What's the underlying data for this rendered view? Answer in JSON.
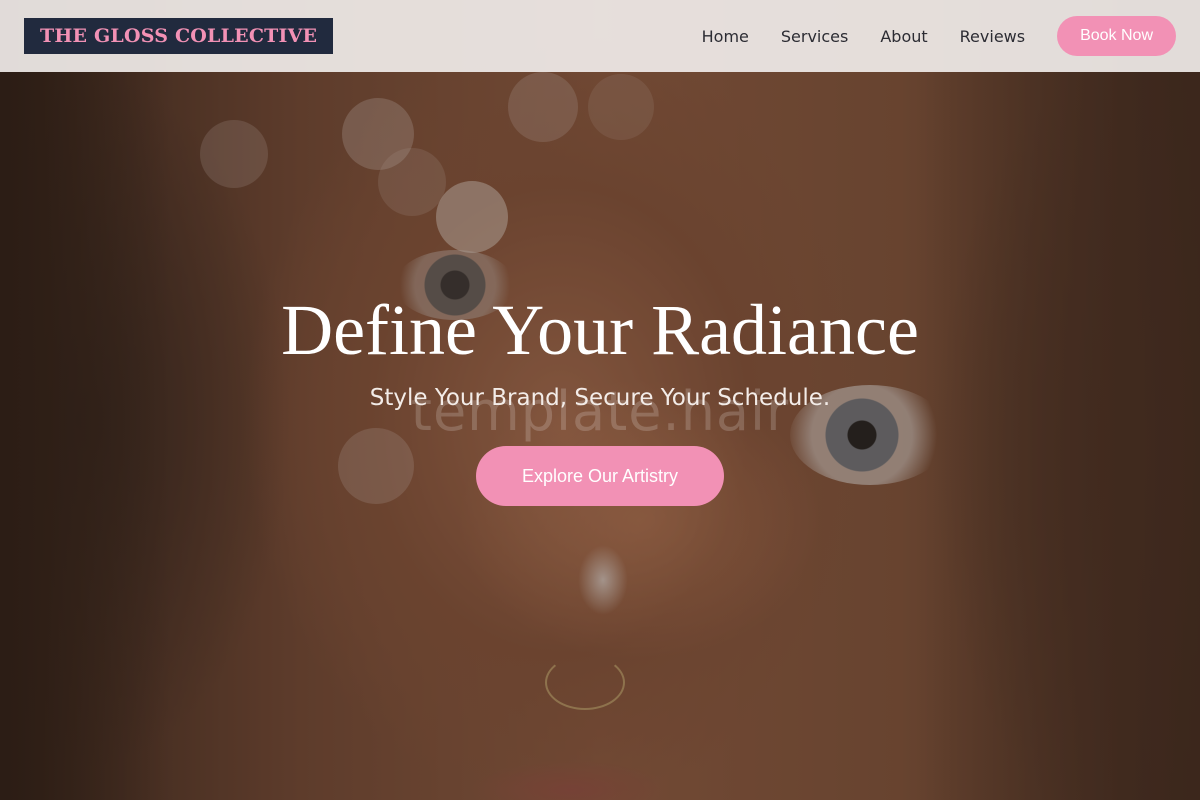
{
  "header": {
    "logo_text": "THE GLOSS COLLECTIVE",
    "nav": [
      {
        "label": "Home"
      },
      {
        "label": "Services"
      },
      {
        "label": "About"
      },
      {
        "label": "Reviews"
      }
    ],
    "cta_label": "Book Now"
  },
  "hero": {
    "title": "Define Your Radiance",
    "subtitle": "Style Your Brand, Secure Your Schedule.",
    "watermark": "template.hair",
    "button_label": "Explore Our Artistry"
  },
  "colors": {
    "accent_pink": "#f291b5",
    "logo_bg": "#212a3e",
    "header_bg": "#f0ece9",
    "nav_text": "#2c2c33"
  }
}
